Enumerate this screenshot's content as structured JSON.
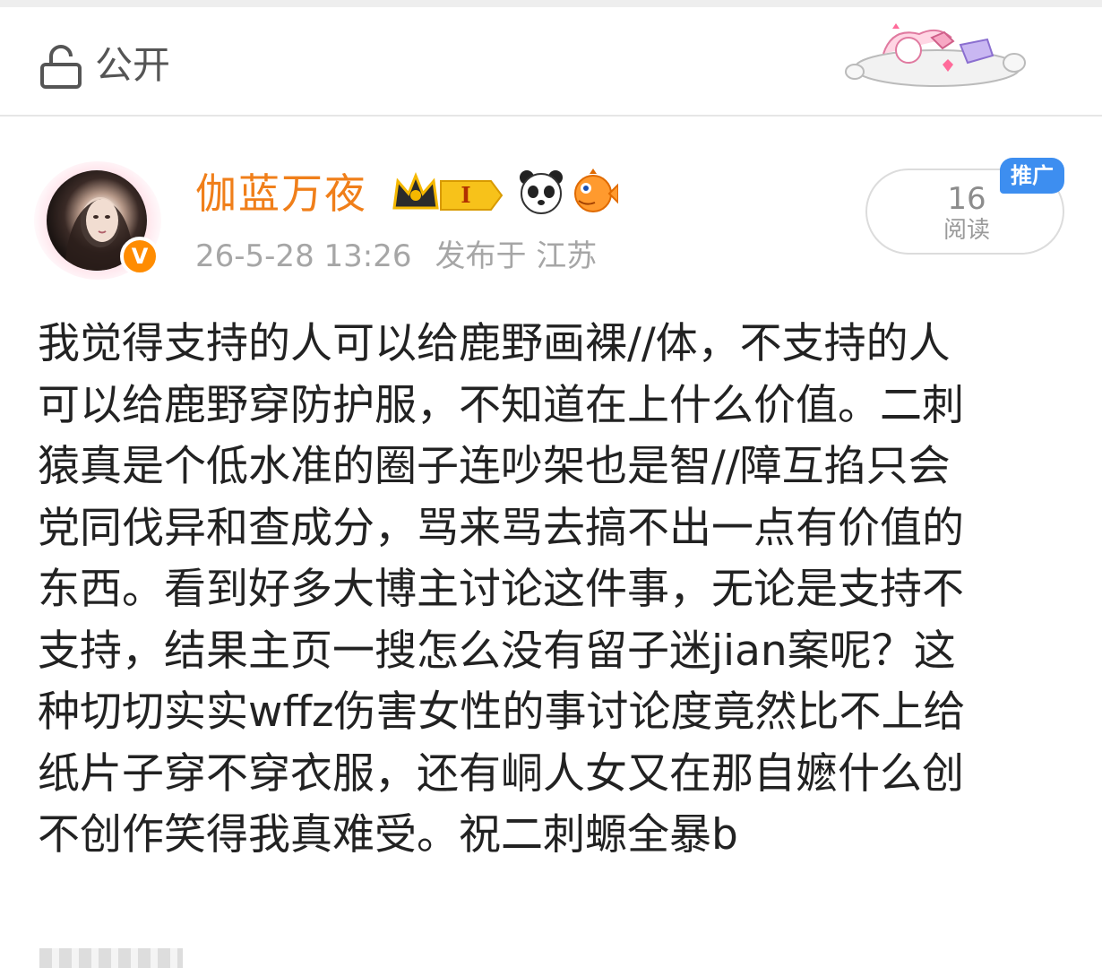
{
  "header": {
    "privacy_label": "公开",
    "icons": {
      "privacy": "lock-icon",
      "decoration": "cartoon-sticker-icon"
    }
  },
  "post": {
    "author": {
      "name": "伽蓝万夜",
      "avatar": "avatar",
      "verified_icon": "verified-v-icon",
      "badge_text": "I",
      "badges": [
        "crown-member-badge",
        "panda-icon",
        "pufferfish-icon"
      ]
    },
    "timestamp": "26-5-28 13:26",
    "location": "发布于 江苏",
    "reads": {
      "count": "16",
      "label": "阅读"
    },
    "promo_label": "推广",
    "content_lines": [
      "我觉得支持的人可以给鹿野画裸//体，不支持的人",
      "可以给鹿野穿防护服，不知道在上什么价值。二刺",
      "猿真是个低水准的圈子连吵架也是智//障互掐只会",
      "党同伐异和查成分，骂来骂去搞不出一点有价值的",
      "东西。看到好多大博主讨论这件事，无论是支持不",
      "支持，结果主页一搜怎么没有留子迷jian案呢？这",
      "种切切实实wffz伤害女性的事讨论度竟然比不上给",
      "纸片子穿不穿衣服，还有峒人女又在那自嬷什么创",
      "不创作笑得我真难受。祝二刺螈全暴b"
    ]
  },
  "colors": {
    "username": "#f07f1a",
    "meta_text": "#a6a6a6",
    "body_text": "#222222",
    "promo_blue": "#3d8ef0",
    "verified_orange": "#ff8c00"
  }
}
